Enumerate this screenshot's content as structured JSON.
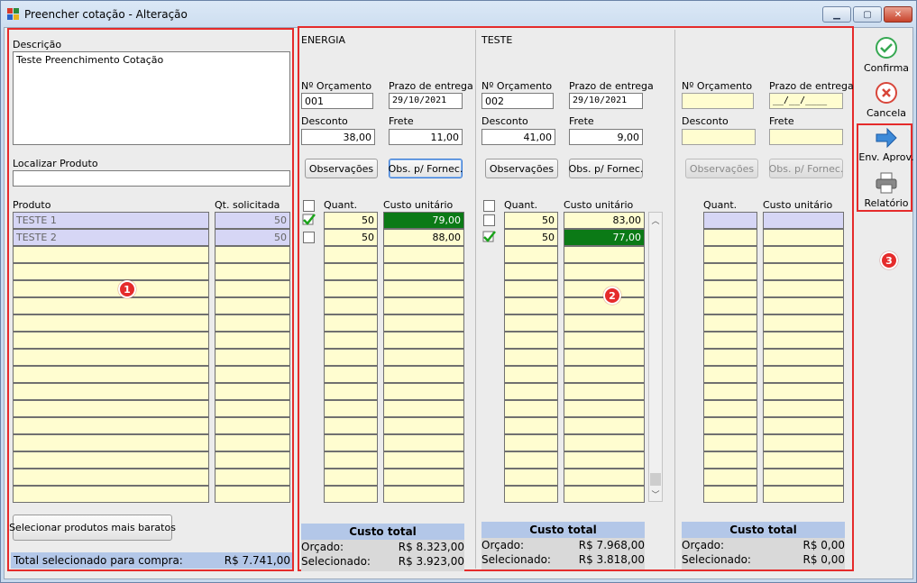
{
  "window": {
    "title": "Preencher cotação - Alteração"
  },
  "left": {
    "descricao_label": "Descrição",
    "descricao_value": "Teste Preenchimento Cotação",
    "localizar_label": "Localizar Produto",
    "localizar_value": "",
    "col_produto": "Produto",
    "col_qt": "Qt. solicitada",
    "rows": [
      {
        "produto": "TESTE 1",
        "qt": "50"
      },
      {
        "produto": "TESTE 2",
        "qt": "50"
      }
    ],
    "btn_baratos": "Selecionar produtos mais baratos",
    "total_label": "Total selecionado para compra:",
    "total_value": "R$ 7.741,00",
    "badge": "1"
  },
  "suppliers": [
    {
      "name": "ENERGIA",
      "orc_label": "Nº Orçamento",
      "orc_value": "001",
      "prazo_label": "Prazo de entrega",
      "prazo_value": "29/10/2021",
      "desc_label": "Desconto",
      "desc_value": "38,00",
      "frete_label": "Frete",
      "frete_value": "11,00",
      "btn_obs": "Observações",
      "btn_obs_fornec": "Obs. p/ Fornec.",
      "col_quant": "Quant.",
      "col_custo": "Custo unitário",
      "rows": [
        {
          "quant": "50",
          "custo": "79,00"
        },
        {
          "quant": "50",
          "custo": "88,00"
        }
      ],
      "total_title": "Custo total",
      "orcado_label": "Orçado:",
      "orcado_value": "R$ 8.323,00",
      "selecionado_label": "Selecionado:",
      "selecionado_value": "R$ 3.923,00"
    },
    {
      "name": "TESTE",
      "orc_label": "Nº Orçamento",
      "orc_value": "002",
      "prazo_label": "Prazo de entrega",
      "prazo_value": "29/10/2021",
      "desc_label": "Desconto",
      "desc_value": "41,00",
      "frete_label": "Frete",
      "frete_value": "9,00",
      "btn_obs": "Observações",
      "btn_obs_fornec": "Obs. p/ Fornec.",
      "col_quant": "Quant.",
      "col_custo": "Custo unitário",
      "rows": [
        {
          "quant": "50",
          "custo": "83,00"
        },
        {
          "quant": "50",
          "custo": "77,00"
        }
      ],
      "total_title": "Custo total",
      "orcado_label": "Orçado:",
      "orcado_value": "R$ 7.968,00",
      "selecionado_label": "Selecionado:",
      "selecionado_value": "R$ 3.818,00"
    },
    {
      "name": "",
      "orc_label": "Nº Orçamento",
      "orc_value": "",
      "prazo_label": "Prazo de entrega",
      "prazo_value": "__/__/____",
      "desc_label": "Desconto",
      "desc_value": "",
      "frete_label": "Frete",
      "frete_value": "",
      "btn_obs": "Observações",
      "btn_obs_fornec": "Obs. p/ Fornec.",
      "col_quant": "Quant.",
      "col_custo": "Custo unitário",
      "total_title": "Custo total",
      "orcado_label": "Orçado:",
      "orcado_value": "R$ 0,00",
      "selecionado_label": "Selecionado:",
      "selecionado_value": "R$ 0,00"
    }
  ],
  "middle_badge": "2",
  "toolbar": {
    "confirma": "Confirma",
    "cancela": "Cancela",
    "env_aprov": "Env. Aprov.",
    "relatorio": "Relatório",
    "badge": "3"
  },
  "colors": {
    "highlight_red": "#e52b2b",
    "selected_green": "#0b7a16",
    "grid_yellow": "#fffdd0",
    "total_blue": "#b3c7e8"
  }
}
